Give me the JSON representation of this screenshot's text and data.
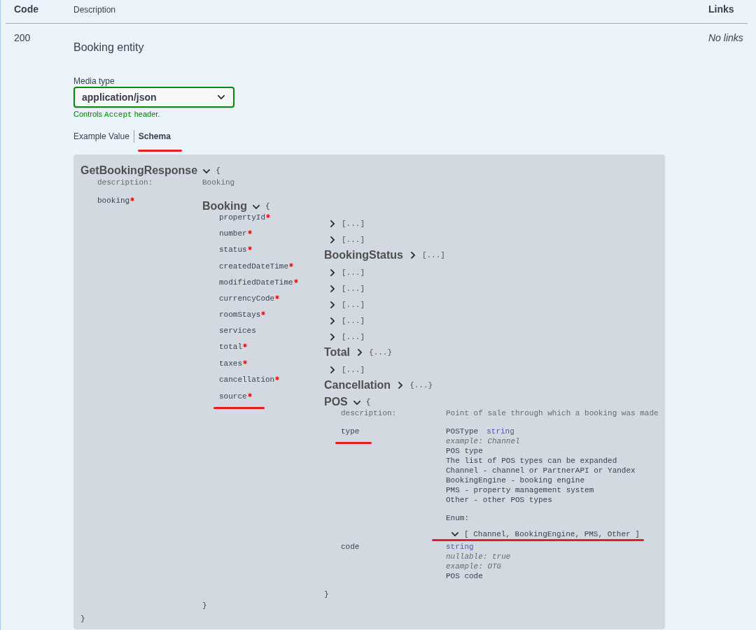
{
  "table": {
    "columns": [
      {
        "label": "Code"
      },
      {
        "label": "Description"
      },
      {
        "label": "Links"
      }
    ]
  },
  "response": {
    "code": "200",
    "description": "Booking entity",
    "links": "No links",
    "media_type": {
      "label": "Media type",
      "value": "application/json",
      "hint": {
        "prefix": "Controls",
        "code": "Accept",
        "suffix": "header."
      }
    },
    "tabs": [
      {
        "label": "Example Value",
        "selected": false,
        "underlined": false
      },
      {
        "label": "Schema",
        "selected": true,
        "underlined": true
      }
    ],
    "schema": {
      "title": "GetBookingResponse",
      "expanded": true,
      "brace_open": "{",
      "brace_close": "}",
      "properties": [
        {
          "kind": "text",
          "name": "description:",
          "required": false,
          "underlined": false,
          "value": "Booking"
        },
        {
          "kind": "model",
          "name": "booking",
          "required": true,
          "underlined": false,
          "model": {
            "title": "Booking",
            "expanded": true,
            "brace_open": "{",
            "brace_close": "}",
            "properties": [
              {
                "kind": "model",
                "name": "propertyId",
                "required": true,
                "underlined": false,
                "model": {
                  "expanded": false,
                  "summary": "[...]"
                }
              },
              {
                "kind": "model",
                "name": "number",
                "required": true,
                "underlined": false,
                "model": {
                  "expanded": false,
                  "summary": "[...]"
                }
              },
              {
                "kind": "model",
                "name": "status",
                "required": true,
                "underlined": false,
                "model": {
                  "title": "BookingStatus",
                  "expanded": false,
                  "summary": "[...]"
                }
              },
              {
                "kind": "model",
                "name": "createdDateTime",
                "required": true,
                "underlined": false,
                "model": {
                  "expanded": false,
                  "summary": "[...]"
                }
              },
              {
                "kind": "model",
                "name": "modifiedDateTime",
                "required": true,
                "underlined": false,
                "model": {
                  "expanded": false,
                  "summary": "[...]"
                }
              },
              {
                "kind": "model",
                "name": "currencyCode",
                "required": true,
                "underlined": false,
                "model": {
                  "expanded": false,
                  "summary": "[...]"
                }
              },
              {
                "kind": "model",
                "name": "roomStays",
                "required": true,
                "underlined": false,
                "model": {
                  "expanded": false,
                  "summary": "[...]"
                }
              },
              {
                "kind": "model",
                "name": "services",
                "required": false,
                "underlined": false,
                "model": {
                  "expanded": false,
                  "summary": "[...]"
                }
              },
              {
                "kind": "model",
                "name": "total",
                "required": true,
                "underlined": false,
                "model": {
                  "title": "Total",
                  "expanded": false,
                  "summary": "{...}"
                }
              },
              {
                "kind": "model",
                "name": "taxes",
                "required": true,
                "underlined": false,
                "model": {
                  "expanded": false,
                  "summary": "[...]"
                }
              },
              {
                "kind": "model",
                "name": "cancellation",
                "required": true,
                "underlined": false,
                "model": {
                  "title": "Cancellation",
                  "expanded": false,
                  "summary": "{...}"
                }
              },
              {
                "kind": "model",
                "name": "source",
                "required": true,
                "underlined": true,
                "model": {
                  "title": "POS",
                  "expanded": true,
                  "brace_open": "{",
                  "brace_close": "}",
                  "properties": [
                    {
                      "kind": "text",
                      "name": "description:",
                      "required": false,
                      "underlined": false,
                      "value": "Point of sale through which a booking was made"
                    },
                    {
                      "kind": "primitive",
                      "name": "type",
                      "required": false,
                      "underlined": true,
                      "lines": [
                        {
                          "kind": "type",
                          "model": "POSType",
                          "type": "string"
                        },
                        {
                          "kind": "meta",
                          "text": "example: Channel"
                        },
                        {
                          "kind": "description",
                          "text": "POS type\nThe list of POS types can be expanded\nChannel - channel or PartnerAPI or Yandex\nBookingEngine - booking engine\nPMS - property management system\nOther - other POS types"
                        },
                        {
                          "kind": "enum",
                          "label": "Enum:",
                          "expanded": true,
                          "values": "[ Channel, BookingEngine, PMS, Other ]",
                          "underlined": true
                        }
                      ]
                    },
                    {
                      "kind": "primitive",
                      "name": "code",
                      "required": false,
                      "underlined": false,
                      "lines": [
                        {
                          "kind": "type",
                          "type": "string"
                        },
                        {
                          "kind": "meta",
                          "text": "nullable: true"
                        },
                        {
                          "kind": "meta",
                          "text": "example: OTG"
                        },
                        {
                          "kind": "description",
                          "text": "POS code"
                        }
                      ]
                    }
                  ]
                }
              }
            ]
          }
        }
      ]
    }
  }
}
